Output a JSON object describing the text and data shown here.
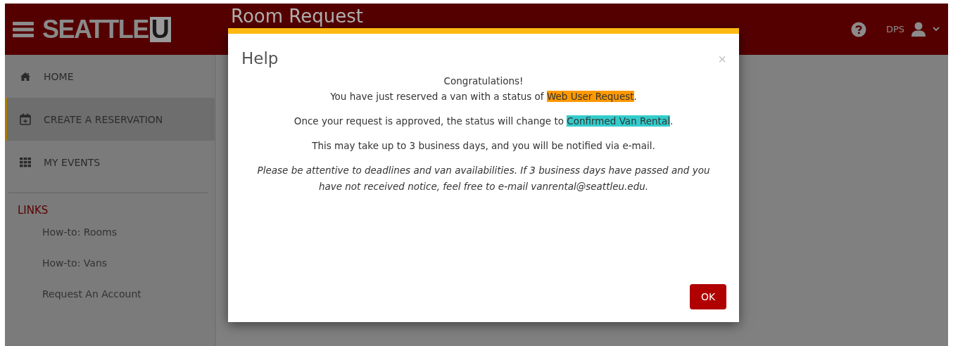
{
  "header": {
    "logo": [
      {
        "text": "SEATTLE",
        "kind": "light"
      },
      {
        "text": "U",
        "kind": "dark"
      }
    ],
    "page_title": "Room Request",
    "user": "DPS"
  },
  "sidebar": {
    "items": [
      {
        "label": "HOME",
        "kind": "home",
        "selected": false
      },
      {
        "label": "CREATE A RESERVATION",
        "kind": "calendar",
        "selected": true
      },
      {
        "label": "MY EVENTS",
        "kind": "grid",
        "selected": false
      }
    ],
    "links_heading": "LINKS",
    "links": [
      "How-to: Rooms",
      "How-to: Vans",
      "Request An Account"
    ]
  },
  "dialog": {
    "title": "Help",
    "close": "×",
    "paragraphs": [
      {
        "lines": [
          {
            "before": "Congratulations!"
          },
          {
            "before": "You have just reserved a van with a status of ",
            "status": {
              "text": "Web User Request",
              "color": "#ff9900"
            },
            "after": "."
          }
        ],
        "italic": false
      },
      {
        "lines": [
          {
            "before": "Once your request is approved, the status will change to ",
            "status": {
              "text": "Confirmed Van Rental",
              "color": "#33cccc"
            },
            "after": "."
          }
        ],
        "italic": false
      },
      {
        "lines": [
          {
            "before": "This may take up to 3 business days, and you will be notified via e-mail."
          }
        ],
        "italic": false
      },
      {
        "lines": [
          {
            "before": "Please be attentive to deadlines and van availabilities. If 3 business days have passed and you have not received notice, feel free to e-mail vanrental@seattleu.edu."
          }
        ],
        "italic": true
      }
    ],
    "ok_button": "OK"
  }
}
